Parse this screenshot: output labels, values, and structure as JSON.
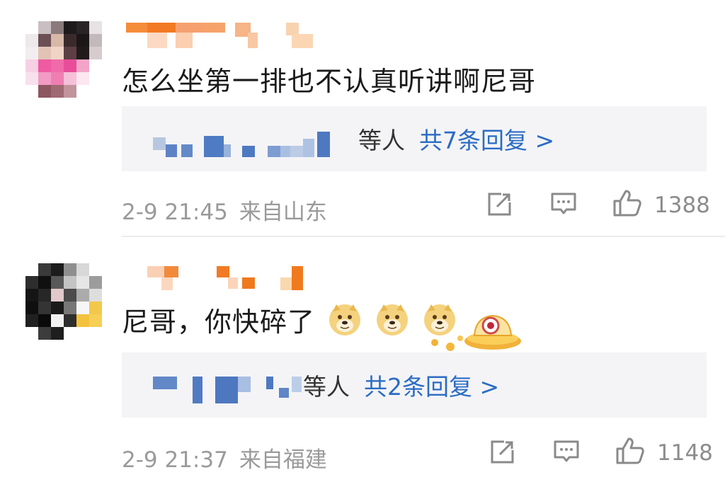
{
  "comments": [
    {
      "text": "怎么坐第一排也不认真听讲啊尼哥",
      "replies": {
        "suffix": "等人",
        "more": "共7条回复 >"
      },
      "time": "2-9 21:45",
      "location": "来自山东",
      "likes": "1388",
      "icons": [
        "share-icon",
        "comment-icon",
        "like-icon"
      ]
    },
    {
      "text": "尼哥，你快碎了",
      "emojis": [
        "doge-emoji",
        "doge-emoji",
        "doge-emoji"
      ],
      "replies": {
        "suffix": "等人",
        "more": "共2条回复 >"
      },
      "time": "2-9 21:37",
      "location": "来自福建",
      "likes": "1148",
      "icons": [
        "share-icon",
        "comment-icon",
        "like-icon"
      ]
    }
  ],
  "colors": {
    "accent": "#2b6cc4",
    "username_orange": "#f07a1e",
    "meta_gray": "#9a9a9a"
  }
}
